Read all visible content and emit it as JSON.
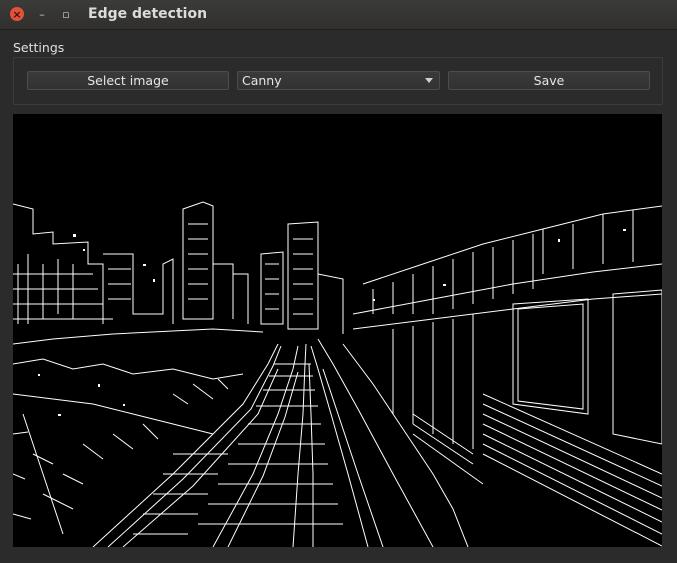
{
  "window": {
    "title": "Edge detection",
    "controls": {
      "close": "×",
      "minimize": "–",
      "maximize": "▫"
    }
  },
  "settings": {
    "group_label": "Settings",
    "select_image_label": "Select image",
    "method": {
      "selected": "Canny"
    },
    "save_label": "Save"
  },
  "image": {
    "description_kind": "canny-edge-output",
    "colors": {
      "background": "#000000",
      "edges": "#ffffff"
    }
  },
  "theme": {
    "window_bg": "#2b2b2b",
    "titlebar": "#34332f",
    "close_button": "#e2513a",
    "button_border": "#4c4c4c"
  }
}
